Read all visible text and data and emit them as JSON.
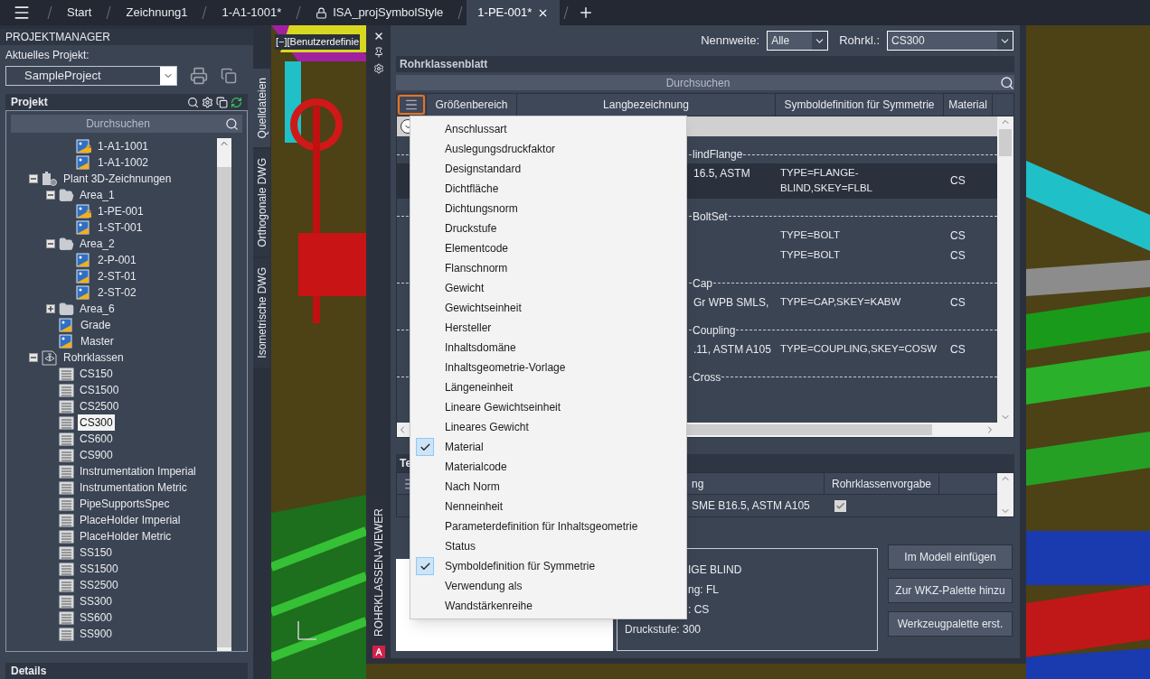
{
  "tabs_bar": {
    "tabs": [
      {
        "label": "Start",
        "selected": false,
        "locked": false
      },
      {
        "label": "Zeichnung1",
        "selected": false,
        "locked": false
      },
      {
        "label": "1-A1-1001*",
        "selected": false,
        "locked": false
      },
      {
        "label": "ISA_projSymbolStyle",
        "selected": false,
        "locked": true
      },
      {
        "label": "1-PE-001*",
        "selected": true,
        "locked": false
      }
    ]
  },
  "project_manager": {
    "title": "PROJEKTMANAGER",
    "current_project_label": "Aktuelles Projekt:",
    "current_project": "SampleProject",
    "section_title": "Projekt",
    "search_placeholder": "Durchsuchen",
    "tree": [
      {
        "children": [
          {
            "children": [
              {
                "label": "1-A1-1001",
                "kind": "drawing",
                "locked": true,
                "selected": false
              },
              {
                "label": "1-A1-1002",
                "kind": "drawing",
                "locked": false,
                "selected": false
              }
            ]
          }
        ]
      },
      {
        "label": "Plant 3D-Zeichnungen",
        "kind": "plant",
        "expanded": true,
        "selected": false,
        "children": [
          {
            "label": "Area_1",
            "kind": "folder",
            "expanded": true,
            "selected": false,
            "children": [
              {
                "label": "1-PE-001",
                "kind": "drawing",
                "locked": true,
                "selected": false
              },
              {
                "label": "1-ST-001",
                "kind": "drawing",
                "locked": false,
                "selected": false
              }
            ]
          },
          {
            "label": "Area_2",
            "kind": "folder",
            "expanded": true,
            "selected": false,
            "children": [
              {
                "label": "2-P-001",
                "kind": "drawing",
                "locked": false,
                "selected": false
              },
              {
                "label": "2-ST-01",
                "kind": "drawing",
                "locked": false,
                "selected": false
              },
              {
                "label": "2-ST-02",
                "kind": "drawing",
                "locked": false,
                "selected": false
              }
            ]
          },
          {
            "label": "Area_6",
            "kind": "folder",
            "expanded": false,
            "selected": false
          },
          {
            "label": "Grade",
            "kind": "drawing",
            "locked": false,
            "selected": false
          },
          {
            "label": "Master",
            "kind": "drawing",
            "locked": false,
            "selected": false
          }
        ]
      },
      {
        "label": "Rohrklassen",
        "kind": "specs",
        "expanded": true,
        "selected": false,
        "children": [
          {
            "label": "CS150",
            "kind": "spec",
            "selected": false
          },
          {
            "label": "CS1500",
            "kind": "spec",
            "selected": false
          },
          {
            "label": "CS2500",
            "kind": "spec",
            "selected": false
          },
          {
            "label": "CS300",
            "kind": "spec",
            "selected": true
          },
          {
            "label": "CS600",
            "kind": "spec",
            "selected": false
          },
          {
            "label": "CS900",
            "kind": "spec",
            "selected": false
          },
          {
            "label": "Instrumentation Imperial",
            "kind": "spec",
            "selected": false
          },
          {
            "label": "Instrumentation Metric",
            "kind": "spec",
            "selected": false
          },
          {
            "label": "PipeSupportsSpec",
            "kind": "spec",
            "selected": false
          },
          {
            "label": "PlaceHolder Imperial",
            "kind": "spec",
            "selected": false
          },
          {
            "label": "PlaceHolder Metric",
            "kind": "spec",
            "selected": false
          },
          {
            "label": "SS150",
            "kind": "spec",
            "selected": false
          },
          {
            "label": "SS1500",
            "kind": "spec",
            "selected": false
          },
          {
            "label": "SS2500",
            "kind": "spec",
            "selected": false
          },
          {
            "label": "SS300",
            "kind": "spec",
            "selected": false
          },
          {
            "label": "SS600",
            "kind": "spec",
            "selected": false
          },
          {
            "label": "SS900",
            "kind": "spec",
            "selected": false
          }
        ]
      }
    ],
    "details_title": "Details"
  },
  "side_tabs": [
    {
      "label": "Quelldateien",
      "selected": true
    },
    {
      "label": "Orthogonale DWG",
      "selected": false
    },
    {
      "label": "Isometrische DWG",
      "selected": false
    }
  ],
  "viewport": {
    "label": "[−][Benutzerdefinie"
  },
  "viewer": {
    "title": "ROHRKLASSEN-VIEWER",
    "nennweite_label": "Nennweite:",
    "nennweite": "Alle",
    "rohrkl_label": "Rohrkl.:",
    "rohrkl": "CS300",
    "sheet_title": "Rohrklassenblatt",
    "search_placeholder": "Durchsuchen",
    "columns": [
      "Größenbereich",
      "Langbezeichnung",
      "Symboldefinition für Symmetrie",
      "Material"
    ],
    "groups": [
      {
        "label": "lindFlange",
        "rows": [
          {
            "long": "16.5, ASTM",
            "symbol": "TYPE=FLANGE-BLIND,SKEY=FLBL",
            "material": "CS",
            "selected": true
          }
        ]
      },
      {
        "label": "BoltSet",
        "rows": [
          {
            "symbol": "TYPE=BOLT",
            "material": "CS",
            "selected": false
          },
          {
            "symbol": "TYPE=BOLT",
            "material": "CS",
            "selected": false
          }
        ]
      },
      {
        "label": "Cap",
        "rows": [
          {
            "long": "Gr WPB SMLS,",
            "symbol": "TYPE=CAP,SKEY=KABW",
            "material": "CS",
            "selected": false
          }
        ]
      },
      {
        "label": "Coupling",
        "rows": [
          {
            "long": ".11, ASTM A105",
            "symbol": "TYPE=COUPLING,SKEY=COSW",
            "material": "CS",
            "selected": false
          }
        ]
      },
      {
        "label": "Cross"
      }
    ],
    "parts": {
      "title": "Te",
      "columns": [
        "ng",
        "Rohrklassenvorgabe"
      ],
      "rows": [
        {
          "description": "SME B16.5, ASTM A105",
          "default": true
        }
      ]
    },
    "info_lines": [
      {
        "text": "IGE BLIND",
        "kind": "partial"
      },
      {
        "text": "ng: FL",
        "kind": "partial"
      },
      {
        "text": ": CS",
        "kind": "partial"
      },
      {
        "text": "Druckstufe: 300",
        "kind": "full"
      }
    ],
    "buttons": [
      "Im Modell einfügen",
      "Zur WKZ-Palette hinzu",
      "Werkzeugpalette erst."
    ],
    "column_menu": [
      {
        "label": "Anschlussart",
        "checked": false
      },
      {
        "label": "Auslegungsdruckfaktor",
        "checked": false
      },
      {
        "label": "Designstandard",
        "checked": false
      },
      {
        "label": "Dichtfläche",
        "checked": false
      },
      {
        "label": "Dichtungsnorm",
        "checked": false
      },
      {
        "label": "Druckstufe",
        "checked": false
      },
      {
        "label": "Elementcode",
        "checked": false
      },
      {
        "label": "Flanschnorm",
        "checked": false
      },
      {
        "label": "Gewicht",
        "checked": false
      },
      {
        "label": "Gewichtseinheit",
        "checked": false
      },
      {
        "label": "Hersteller",
        "checked": false
      },
      {
        "label": "Inhaltsdomäne",
        "checked": false
      },
      {
        "label": "Inhaltsgeometrie-Vorlage",
        "checked": false
      },
      {
        "label": "Längeneinheit",
        "checked": false
      },
      {
        "label": "Lineare Gewichtseinheit",
        "checked": false
      },
      {
        "label": "Lineares Gewicht",
        "checked": false
      },
      {
        "label": "Material",
        "checked": true
      },
      {
        "label": "Materialcode",
        "checked": false
      },
      {
        "label": "Nach Norm",
        "checked": false
      },
      {
        "label": "Nenneinheit",
        "checked": false
      },
      {
        "label": "Parameterdefinition für Inhaltsgeometrie",
        "checked": false
      },
      {
        "label": "Status",
        "checked": false
      },
      {
        "label": "Symboldefinition für Symmetrie",
        "checked": true
      },
      {
        "label": "Verwendung als",
        "checked": false
      },
      {
        "label": "Wandstärkenreihe",
        "checked": false
      }
    ]
  }
}
